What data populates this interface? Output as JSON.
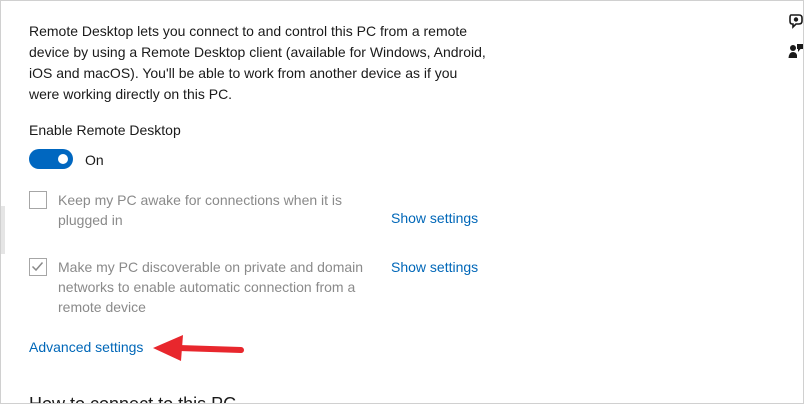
{
  "description": "Remote Desktop lets you connect to and control this PC from a remote device by using a Remote Desktop client (available for Windows, Android, iOS and macOS). You'll be able to work from another device as if you were working directly on this PC.",
  "enable_remote_desktop": {
    "label": "Enable Remote Desktop",
    "state_text": "On",
    "checked": true
  },
  "options": [
    {
      "label": "Keep my PC awake for connections when it is plugged in",
      "checked": false,
      "link": "Show settings"
    },
    {
      "label": "Make my PC discoverable on private and domain networks to enable automatic connection from a remote device",
      "checked": true,
      "link": "Show settings"
    }
  ],
  "advanced_link": "Advanced settings",
  "next_heading": "How to connect to this PC",
  "icons": [
    "get-help-icon",
    "give-feedback-icon",
    "red-arrow-annotation"
  ],
  "colors": {
    "accent": "#0067c0",
    "link": "#0067b8",
    "disabled_text": "#8a8a8a",
    "annotation": "#e8272d"
  }
}
